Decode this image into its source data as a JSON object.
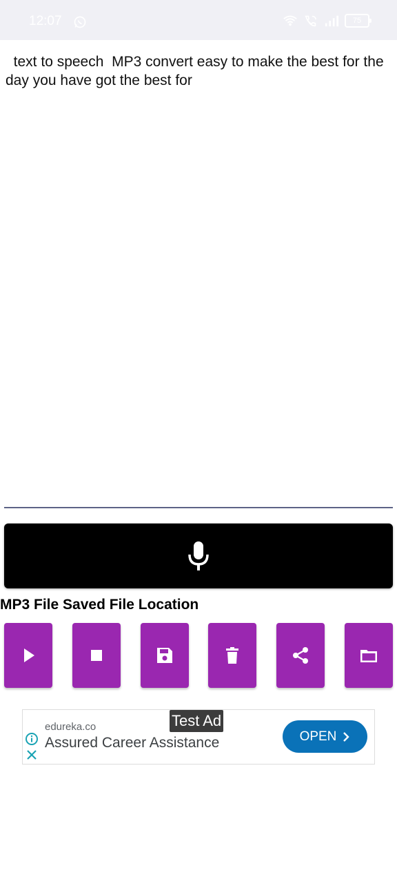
{
  "status_bar": {
    "time": "12:07",
    "battery": "75",
    "icons": [
      "whatsapp-icon",
      "wifi-icon",
      "wifi-calling-icon",
      "signal-icon",
      "battery-icon"
    ]
  },
  "editor": {
    "text": "  text to speech  MP3 convert easy to make the best for the day you have got the best for"
  },
  "mic_button": {
    "icon": "microphone-icon",
    "color": "#000000"
  },
  "file_location_label": "MP3 File Saved File Location",
  "actions": [
    {
      "name": "play",
      "icon": "play-icon"
    },
    {
      "name": "stop",
      "icon": "stop-icon"
    },
    {
      "name": "save",
      "icon": "save-icon"
    },
    {
      "name": "delete",
      "icon": "trash-icon"
    },
    {
      "name": "share",
      "icon": "share-icon"
    },
    {
      "name": "folder",
      "icon": "folder-icon"
    }
  ],
  "accent_color": "#9a27b0",
  "ad": {
    "badge": "Test Ad",
    "domain": "edureka.co",
    "headline": "Assured Career Assistance",
    "cta": "OPEN",
    "cta_color": "#0a72b8"
  }
}
